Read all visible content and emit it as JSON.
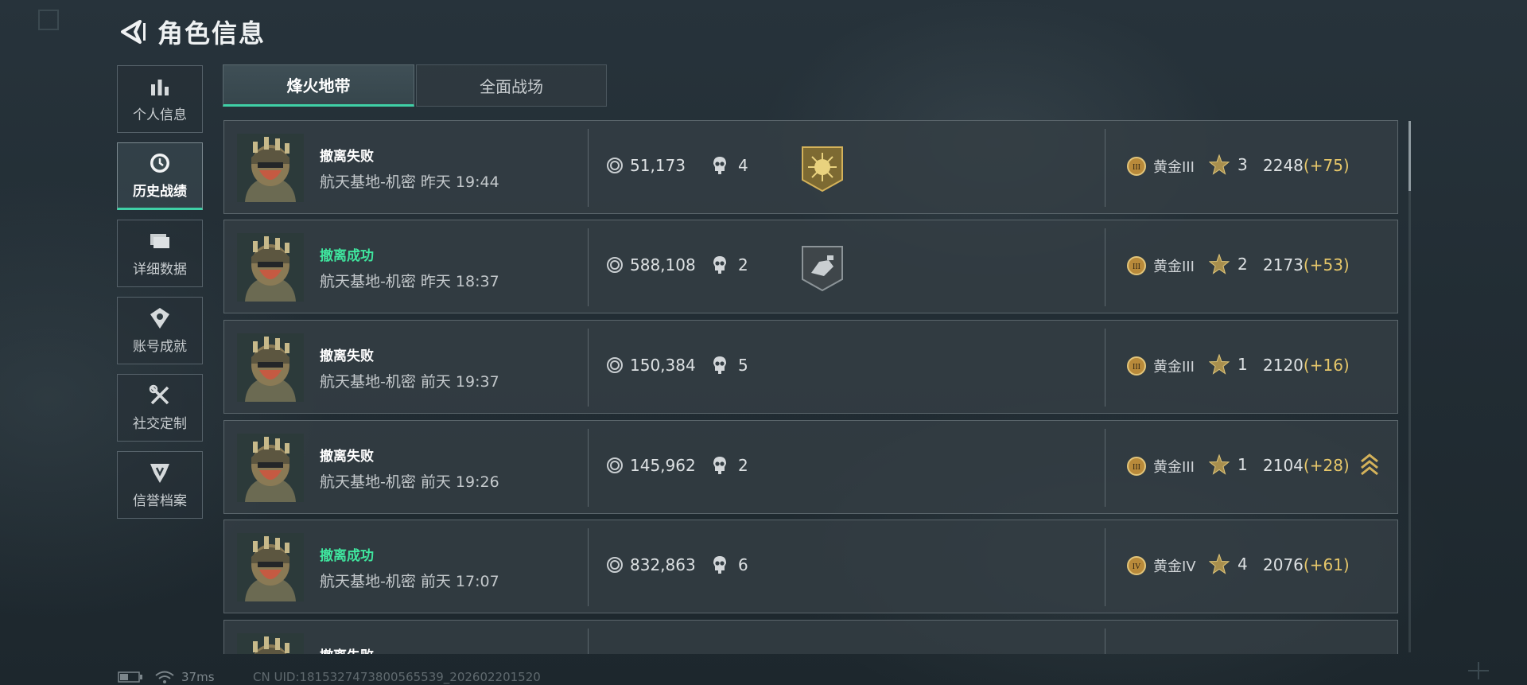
{
  "header": {
    "title": "角色信息"
  },
  "sidebar": {
    "items": [
      {
        "label": "个人信息",
        "icon": "bar-chart-icon"
      },
      {
        "label": "历史战绩",
        "icon": "clock-icon",
        "active": true
      },
      {
        "label": "详细数据",
        "icon": "folders-icon"
      },
      {
        "label": "账号成就",
        "icon": "achievement-icon"
      },
      {
        "label": "社交定制",
        "icon": "tools-icon"
      },
      {
        "label": "信誉档案",
        "icon": "shield-icon"
      }
    ]
  },
  "tabs": [
    {
      "label": "烽火地带",
      "active": true
    },
    {
      "label": "全面战场",
      "active": false
    }
  ],
  "matches": [
    {
      "result": "撤离失败",
      "result_status": "fail",
      "location": "航天基地-机密 昨天 19:44",
      "value": "51,173",
      "kills": "4",
      "badge": "gold-star-badge-icon",
      "rank_numeral": "III",
      "rank": "黄金III",
      "stars": "3",
      "score": "2248",
      "delta": "(+75)",
      "rank_up": false
    },
    {
      "result": "撤离成功",
      "result_status": "success",
      "location": "航天基地-机密 昨天 18:37",
      "value": "588,108",
      "kills": "2",
      "badge": "silver-hand-badge-icon",
      "rank_numeral": "III",
      "rank": "黄金III",
      "stars": "2",
      "score": "2173",
      "delta": "(+53)",
      "rank_up": false
    },
    {
      "result": "撤离失败",
      "result_status": "fail",
      "location": "航天基地-机密 前天 19:37",
      "value": "150,384",
      "kills": "5",
      "badge": "",
      "rank_numeral": "III",
      "rank": "黄金III",
      "stars": "1",
      "score": "2120",
      "delta": "(+16)",
      "rank_up": false
    },
    {
      "result": "撤离失败",
      "result_status": "fail",
      "location": "航天基地-机密 前天 19:26",
      "value": "145,962",
      "kills": "2",
      "badge": "",
      "rank_numeral": "III",
      "rank": "黄金III",
      "stars": "1",
      "score": "2104",
      "delta": "(+28)",
      "rank_up": true
    },
    {
      "result": "撤离成功",
      "result_status": "success",
      "location": "航天基地-机密 前天 17:07",
      "value": "832,863",
      "kills": "6",
      "badge": "",
      "rank_numeral": "IV",
      "rank": "黄金IV",
      "stars": "4",
      "score": "2076",
      "delta": "(+61)",
      "rank_up": false
    },
    {
      "result": "撤离失败",
      "result_status": "fail",
      "location": "",
      "value": "",
      "kills": "",
      "badge": "",
      "rank_numeral": "",
      "rank": "",
      "stars": "",
      "score": "",
      "delta": "",
      "rank_up": false
    }
  ],
  "status_bar": {
    "ping": "37ms",
    "uid": "CN UID:1815327473800565539_202602201520"
  },
  "colors": {
    "accent": "#3fd0a6",
    "success": "#3fe69e",
    "delta": "#e6c76a",
    "gold": "#d4b25a"
  }
}
